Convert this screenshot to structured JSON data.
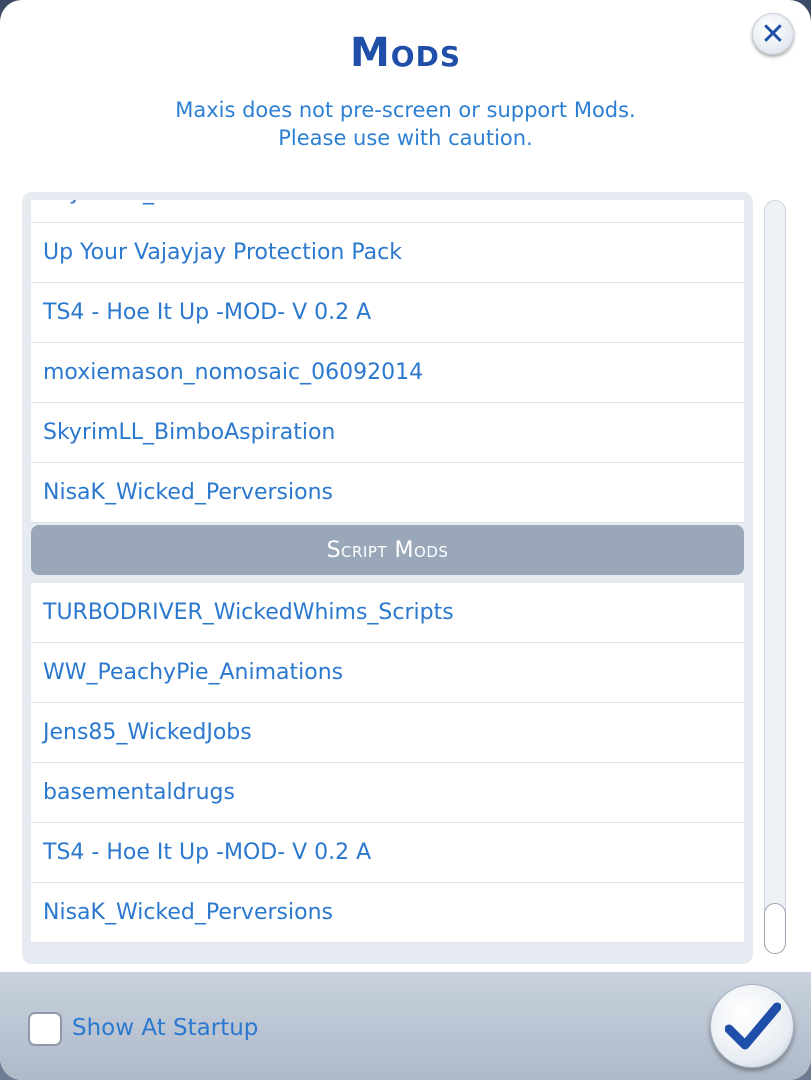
{
  "dialog": {
    "title": "Mods",
    "subtitle_line1": "Maxis does not pre-screen or support Mods.",
    "subtitle_line2": "Please use with caution.",
    "close_icon": "close-icon"
  },
  "mods_list": {
    "partial_top_item": "SkyrimLL_BimboTrait",
    "package_mods": [
      "Up Your Vajayjay Protection Pack",
      "TS4  - Hoe It Up -MOD- V 0.2 A",
      "moxiemason_nomosaic_06092014",
      "SkyrimLL_BimboAspiration",
      "NisaK_Wicked_Perversions"
    ],
    "script_section_label": "Script Mods",
    "script_mods": [
      "TURBODRIVER_WickedWhims_Scripts",
      "WW_PeachyPie_Animations",
      "Jens85_WickedJobs",
      "basementaldrugs",
      "TS4  - Hoe It Up -MOD- V 0.2 A",
      "NisaK_Wicked_Perversions"
    ]
  },
  "footer": {
    "show_at_startup_label": "Show At Startup",
    "show_at_startup_checked": false,
    "confirm_icon": "checkmark-icon"
  },
  "colors": {
    "title": "#1f4fa8",
    "link_text": "#2b78cf",
    "section_header_bg": "#9aa7b8"
  }
}
